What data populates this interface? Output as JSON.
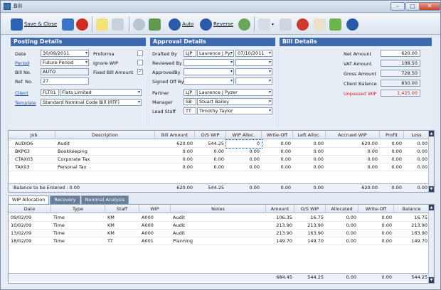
{
  "window": {
    "title": "Bill",
    "minimize": "–",
    "maximize": "□",
    "close": "✕"
  },
  "toolbar": {
    "save_close": "Save & Close",
    "auto": "Auto",
    "reverse": "Reverse"
  },
  "posting": {
    "header": "Posting Details",
    "date_label": "Date",
    "date": "30/09/2011",
    "period_label": "Period",
    "period": "Future Period",
    "billno_label": "Bill No.",
    "billno": "AUTO",
    "refno_label": "Ref. No.",
    "refno": "27",
    "client_label": "Client",
    "client_code": "FLT01",
    "client_name": "Flats Limited",
    "template_label": "Template",
    "template": "Standard Nominal Code Bill (RTF)",
    "proforma_label": "Proforma",
    "ignore_wip_label": "Ignore WIP",
    "fixed_label": "Fixed Bill Amount",
    "proforma_checked": false,
    "ignore_wip_checked": false,
    "fixed_checked": true
  },
  "approval": {
    "header": "Approval Details",
    "drafted_label": "Drafted By",
    "drafted_code": "LJP",
    "drafted_name": "Laurence J Py:",
    "drafted_date": "07/10/2011",
    "reviewed_label": "Reviewed By",
    "approved_label": "ApprovedBy",
    "signed_label": "Signed Off By",
    "partner_label": "Partner",
    "partner_code": "LJP",
    "partner_name": "Laurence J Pyzer",
    "manager_label": "Manager",
    "manager_code": "SB",
    "manager_name": "Stuart Bailey",
    "lead_label": "Lead Staff",
    "lead_code": "TT",
    "lead_name": "Timothy Taylor"
  },
  "bill": {
    "header": "Bill Details",
    "net_label": "Net Amount",
    "net": "620.00",
    "vat_label": "VAT Amount",
    "vat": "108.50",
    "gross_label": "Gross Amount",
    "gross": "728.50",
    "client_bal_label": "Client Balance",
    "client_bal": "850.00",
    "unpassed_label": "Unpassed WIP",
    "unpassed": "1,425.00"
  },
  "jobs": {
    "columns": [
      "Job",
      "Description",
      "Bill Amount",
      "O/S WIP",
      "WIP Alloc.",
      "Write-Off",
      "Left Alloc.",
      "Accrued WIP",
      "Profit",
      "Loss"
    ],
    "rows": [
      {
        "job": "AUDIO6",
        "desc": "Audit",
        "bill": "620.00",
        "os": "544.25",
        "alloc": "0",
        "wo": "0.00",
        "left": "0.00",
        "accrued": "620.00",
        "profit": "0.00",
        "loss": "0.00"
      },
      {
        "job": "BKP03",
        "desc": "Bookkeeping",
        "bill": "0.00",
        "os": "0.00",
        "alloc": "0.00",
        "wo": "0.00",
        "left": "0.00",
        "accrued": "0.00",
        "profit": "0.00",
        "loss": "0.00"
      },
      {
        "job": "CTAX03",
        "desc": "Corporate Tax",
        "bill": "0.00",
        "os": "0.00",
        "alloc": "0.00",
        "wo": "0.00",
        "left": "0.00",
        "accrued": "0.00",
        "profit": "0.00",
        "loss": "0.00"
      },
      {
        "job": "TAX03",
        "desc": "Personal Tax",
        "bill": "0.00",
        "os": "0.00",
        "alloc": "0.00",
        "wo": "0.00",
        "left": "0.00",
        "accrued": "0.00",
        "profit": "0.00",
        "loss": "0.00"
      }
    ],
    "totals_label": "Balance to be Entered : 0.00",
    "totals": {
      "bill": "620.00",
      "os": "544.25",
      "alloc": "0.00",
      "wo": "0.00",
      "left": "0.00",
      "accrued": "620.00",
      "profit": "0.00",
      "loss": "0.00"
    }
  },
  "tabs": [
    "WIP Allocation",
    "Recovery",
    "Nominal Analysis"
  ],
  "wip": {
    "columns": [
      "Date",
      "Type",
      "Staff",
      "WIP",
      "Notes",
      "Amount",
      "O/S WIP",
      "Allocated",
      "Write-Off",
      "Balance"
    ],
    "rows": [
      {
        "date": "09/02/09",
        "type": "Time",
        "staff": "KM",
        "wip": "A000",
        "notes": "Audit",
        "amount": "106.35",
        "os": "16.75",
        "alloc": "0.00",
        "wo": "0.00",
        "bal": "16.75"
      },
      {
        "date": "10/02/09",
        "type": "Time",
        "staff": "KM",
        "wip": "A000",
        "notes": "Audit",
        "amount": "213.90",
        "os": "213.90",
        "alloc": "0.00",
        "wo": "0.00",
        "bal": "213.90"
      },
      {
        "date": "13/02/09",
        "type": "Time",
        "staff": "KM",
        "wip": "A000",
        "notes": "Audit",
        "amount": "213.90",
        "os": "163.90",
        "alloc": "0.00",
        "wo": "0.00",
        "bal": "163.90"
      },
      {
        "date": "18/02/09",
        "type": "Time",
        "staff": "TT",
        "wip": "A001",
        "notes": "Planning",
        "amount": "149.70",
        "os": "149.70",
        "alloc": "0.00",
        "wo": "0.00",
        "bal": "149.70"
      }
    ],
    "totals": {
      "amount": "684.45",
      "os": "544.25",
      "alloc": "0.00",
      "wo": "0.00",
      "bal": "544.25"
    }
  }
}
